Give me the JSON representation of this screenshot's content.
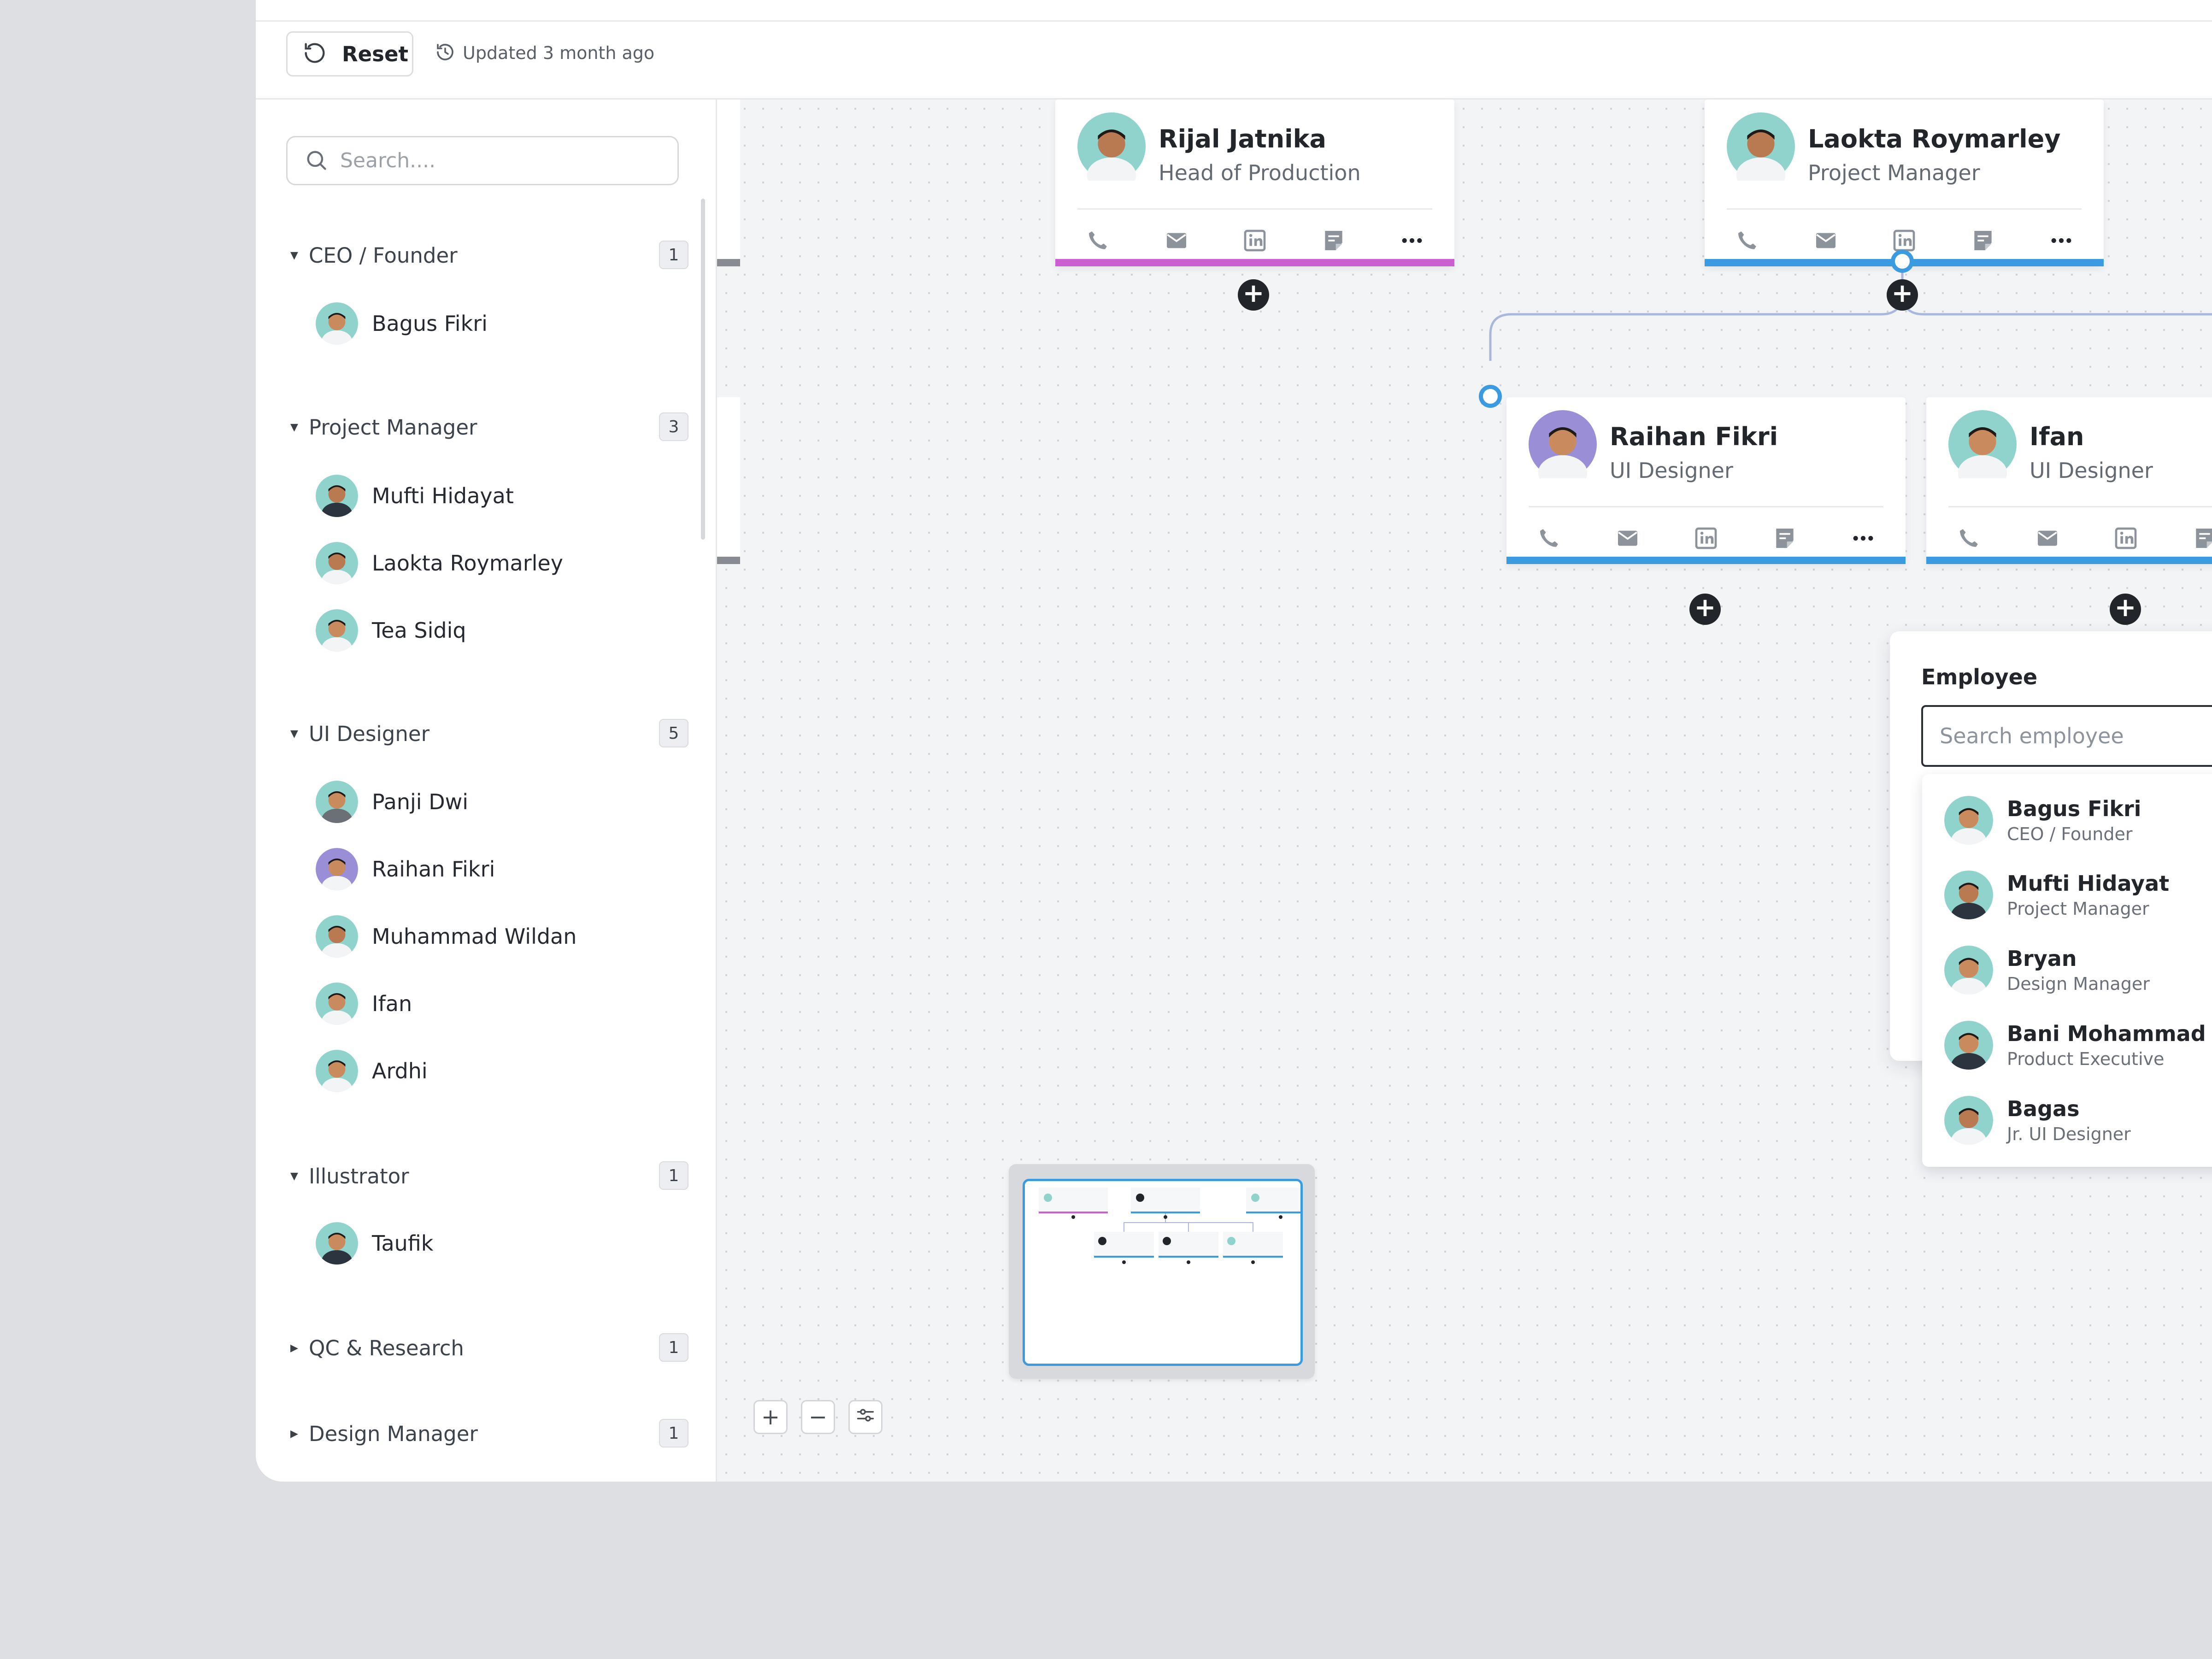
{
  "toolbar": {
    "reset_label": "Reset",
    "updated_text": "Updated 3 month ago"
  },
  "sidebar": {
    "search_placeholder": "Search....",
    "groups": [
      {
        "title": "CEO / Founder",
        "count": "1",
        "expanded": true,
        "people": [
          "Bagus Fikri"
        ]
      },
      {
        "title": "Project Manager",
        "count": "3",
        "expanded": true,
        "people": [
          "Mufti Hidayat",
          "Laokta Roymarley",
          "Tea Sidiq"
        ]
      },
      {
        "title": "UI Designer",
        "count": "5",
        "expanded": true,
        "people": [
          "Panji Dwi",
          "Raihan Fikri",
          "Muhammad Wildan",
          "Ifan",
          "Ardhi"
        ]
      },
      {
        "title": "Illustrator",
        "count": "1",
        "expanded": true,
        "people": [
          "Taufik"
        ]
      },
      {
        "title": "QC & Research",
        "count": "1",
        "expanded": false,
        "people": []
      },
      {
        "title": "Design Manager",
        "count": "1",
        "expanded": false,
        "people": []
      }
    ]
  },
  "cards": [
    {
      "name": "Rijal Jatnika",
      "role": "Head of Production",
      "accent": "#c95fd0"
    },
    {
      "name": "Laokta Roymarley",
      "role": "Project Manager",
      "accent": "#3a9be0"
    },
    {
      "name": "Raihan Fikri",
      "role": "UI Designer",
      "accent": "#3a9be0"
    },
    {
      "name": "Ifan",
      "role": "UI Designer",
      "accent": "#3a9be0"
    }
  ],
  "employee_popup": {
    "title": "Employee",
    "search_placeholder": "Search employee",
    "results": [
      {
        "name": "Bagus Fikri",
        "role": "CEO / Founder"
      },
      {
        "name": "Mufti Hidayat",
        "role": "Project Manager"
      },
      {
        "name": "Bryan",
        "role": "Design Manager"
      },
      {
        "name": "Bani Mohammad",
        "role": "Product Executive"
      },
      {
        "name": "Bagas",
        "role": "Jr. UI Designer"
      }
    ]
  },
  "zoom_controls": {
    "zoom_in": "+",
    "zoom_out": "−"
  },
  "colors": {
    "accent_blue": "#3a9be0",
    "accent_purple": "#c95fd0",
    "dark": "#22252a"
  }
}
